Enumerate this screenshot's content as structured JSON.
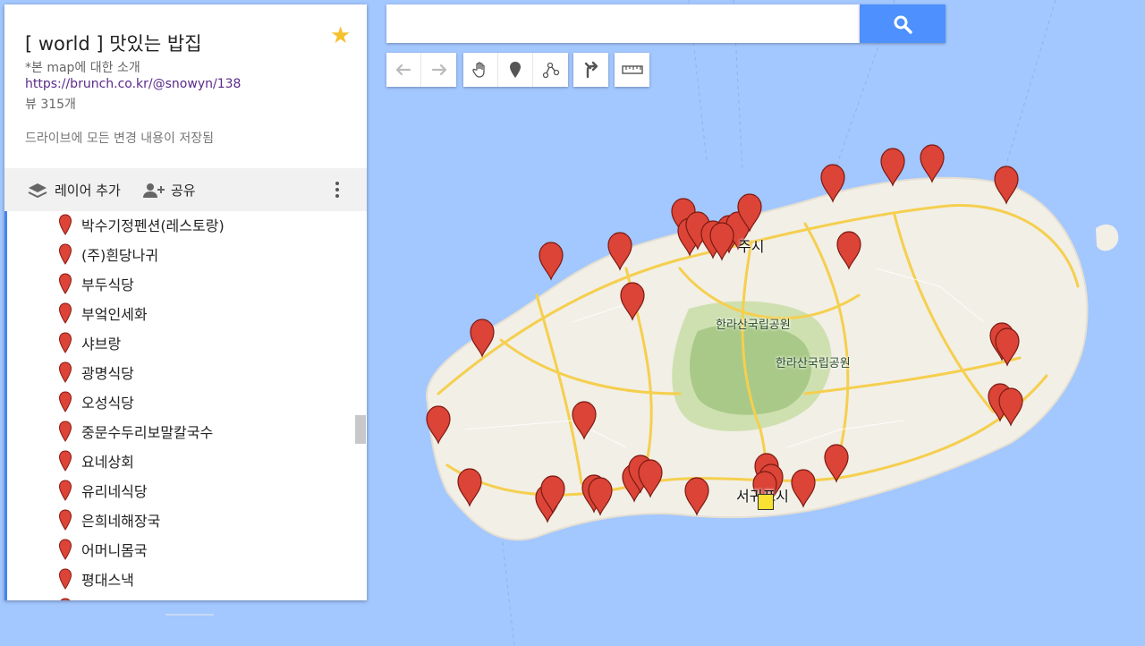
{
  "map_info": {
    "title": "[ world ] 맛있는 밥집",
    "description": "*본 map에 대한 소개",
    "link": "https://brunch.co.kr/@snowyn/138",
    "views": "뷰 315개",
    "saved_status": "드라이브에 모든 변경 내용이 저장됨",
    "star_icon": "star-icon"
  },
  "toolbar": {
    "add_layer": "레이어 추가",
    "share": "공유",
    "more_icon": "more-vert-icon"
  },
  "list": {
    "items": [
      "박수기정펜션(레스토랑)",
      "(주)흰당나귀",
      "부두식당",
      "부엌인세화",
      "샤브랑",
      "광명식당",
      "오성식당",
      "중문수두리보말칼국수",
      "요네상회",
      "유리네식당",
      "은희네해장국",
      "어머니몸국",
      "평대스낵"
    ]
  },
  "search": {
    "value": "",
    "icon": "search-icon"
  },
  "tools": [
    "undo-icon",
    "redo-icon",
    "hand-icon",
    "marker-icon",
    "line-icon",
    "directions-icon",
    "ruler-icon"
  ],
  "map_labels": {
    "park1": "한라산국립공원",
    "park2": "한라산국립공원",
    "city_north": "주시",
    "city_south": "서귀포시"
  },
  "colors": {
    "water": "#a3c7ff",
    "land": "#f2efe6",
    "marker": "#db4437",
    "accent": "#4285f4",
    "search_button": "#4d90fe",
    "road": "#f5cf4f"
  }
}
